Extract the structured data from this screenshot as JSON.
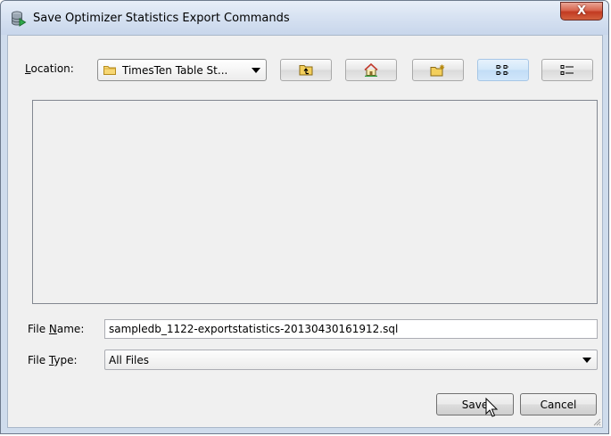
{
  "window": {
    "title": "Save Optimizer Statistics Export Commands",
    "close_label": "X"
  },
  "location": {
    "label_prefix": "L",
    "label_rest": "ocation:",
    "value": "TimesTen Table St..."
  },
  "toolbar": {
    "buttons": [
      {
        "icon": "up-folder-icon"
      },
      {
        "icon": "home-icon"
      },
      {
        "icon": "new-folder-icon"
      },
      {
        "icon": "list-view-icon",
        "active": true
      },
      {
        "icon": "details-view-icon"
      }
    ]
  },
  "file_name": {
    "label_prefix": "File ",
    "label_key": "N",
    "label_rest": "ame:",
    "value": "sampledb_1122-exportstatistics-20130430161912.sql"
  },
  "file_type": {
    "label_prefix": "File ",
    "label_key": "T",
    "label_rest": "ype:",
    "value": "All Files"
  },
  "buttons": {
    "save": "Save",
    "cancel": "Cancel"
  },
  "colors": {
    "titlebar": "#d3dff0",
    "close": "#c23a22",
    "dialog_bg": "#f0f0f0",
    "active_toggle": "#d2e7fa"
  }
}
